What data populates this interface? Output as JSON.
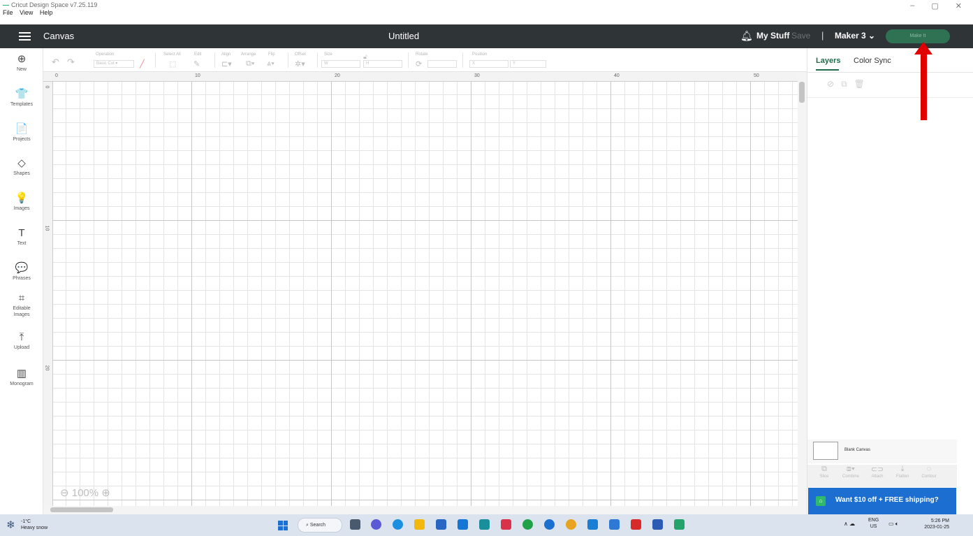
{
  "window": {
    "app_title": "Cricut Design Space  v7.25.119",
    "minimize": "–",
    "maximize": "▢",
    "close": "✕"
  },
  "menu": [
    "File",
    "View",
    "Help"
  ],
  "header": {
    "section": "Canvas",
    "title": "Untitled",
    "mystuff": "My Stuff",
    "save": "Save",
    "sep": "|",
    "machine": "Maker 3",
    "makeit": "Make It"
  },
  "sidebar": [
    {
      "icon": "⊕",
      "label": "New"
    },
    {
      "icon": "👕",
      "label": "Templates"
    },
    {
      "icon": "📄",
      "label": "Projects"
    },
    {
      "icon": "◇",
      "label": "Shapes"
    },
    {
      "icon": "💡",
      "label": "Images"
    },
    {
      "icon": "T",
      "label": "Text"
    },
    {
      "icon": "💬",
      "label": "Phrases"
    },
    {
      "icon": "⌗",
      "label": "Editable\nImages"
    },
    {
      "icon": "⤒",
      "label": "Upload"
    },
    {
      "icon": "▥",
      "label": "Monogram"
    }
  ],
  "toolbar": {
    "operation": "Operation",
    "operation_value": "Basic Cut",
    "select_all": "Select All",
    "edit": "Edit",
    "align": "Align",
    "arrange": "Arrange",
    "flip": "Flip",
    "offset": "Offset",
    "size": "Size",
    "w": "W",
    "h": "H",
    "rotate": "Rotate",
    "position": "Position",
    "x": "X",
    "y": "Y"
  },
  "ruler": {
    "top": [
      "0",
      "10",
      "20",
      "30",
      "40",
      "50"
    ],
    "left": [
      "0",
      "10",
      "20"
    ]
  },
  "zoom": "100%",
  "panel": {
    "tab_layers": "Layers",
    "tab_colorsync": "Color Sync",
    "blank_canvas": "Blank Canvas",
    "ops": [
      "Slice",
      "Combine",
      "Attach",
      "Flatten",
      "Contour"
    ]
  },
  "promo": "Want $10 off + FREE shipping?",
  "taskbar": {
    "temp": "-1°C",
    "weather": "Heavy snow",
    "search": "Search",
    "lang1": "ENG",
    "lang2": "US",
    "time": "5:26 PM",
    "date": "2023-01-25"
  }
}
